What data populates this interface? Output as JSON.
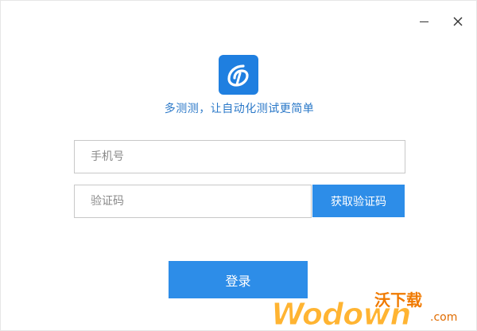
{
  "window": {
    "minimize_icon": "minimize-icon",
    "close_icon": "close-icon",
    "close_glyph": "✕"
  },
  "brand": {
    "logo_icon": "app-logo-icon",
    "logo_color": "#1f7fe0",
    "tagline": "多测测，让自动化测试更简单"
  },
  "form": {
    "phone_placeholder": "手机号",
    "phone_value": "",
    "code_placeholder": "验证码",
    "code_value": "",
    "get_code_label": "获取验证码",
    "login_label": "登录"
  },
  "watermark": {
    "top_text": "沃下载",
    "main_text": "Wodown",
    "suffix_text": ".com"
  },
  "colors": {
    "accent": "#2d8de8",
    "tagline": "#2a78c8",
    "border": "#c8c8c8"
  }
}
